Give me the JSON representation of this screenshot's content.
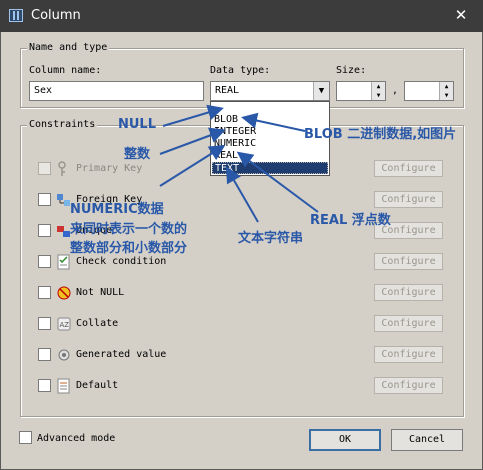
{
  "window": {
    "title": "Column",
    "close_glyph": "✕"
  },
  "name_type": {
    "legend": "Name and type",
    "column_name_label": "Column name:",
    "column_name_value": "Sex",
    "data_type_label": "Data type:",
    "data_type_value": "REAL",
    "size_label": "Size:",
    "size_separator": ",",
    "data_type_options": [
      "BLOB",
      "INTEGER",
      "NUMERIC",
      "REAL",
      "TEXT"
    ],
    "highlighted_option": "TEXT"
  },
  "constraints": {
    "legend": "Constraints",
    "configure_label": "Configure",
    "items": [
      {
        "label": "Primary Key",
        "icon": "key-icon",
        "enabled": false
      },
      {
        "label": "Foreign Key",
        "icon": "foreign-key-icon",
        "enabled": true
      },
      {
        "label": "Unique",
        "icon": "unique-icon",
        "enabled": true
      },
      {
        "label": "Check condition",
        "icon": "check-condition-icon",
        "enabled": true
      },
      {
        "label": "Not NULL",
        "icon": "not-null-icon",
        "enabled": true
      },
      {
        "label": "Collate",
        "icon": "collate-icon",
        "enabled": true
      },
      {
        "label": "Generated value",
        "icon": "generated-value-icon",
        "enabled": true
      },
      {
        "label": "Default",
        "icon": "default-icon",
        "enabled": true
      }
    ]
  },
  "footer": {
    "advanced_mode_label": "Advanced mode",
    "ok_label": "OK",
    "cancel_label": "Cancel"
  },
  "annotations": {
    "null": "NULL",
    "integer": "整数",
    "numeric_line1": "NUMERIC数据",
    "numeric_line2": "来同时表示一个数的",
    "numeric_line3": "整数部分和小数部分",
    "blob": "BLOB 二进制数据,如图片",
    "real": "REAL 浮点数",
    "text": "文本字符串",
    "color": "#2a58a8"
  }
}
